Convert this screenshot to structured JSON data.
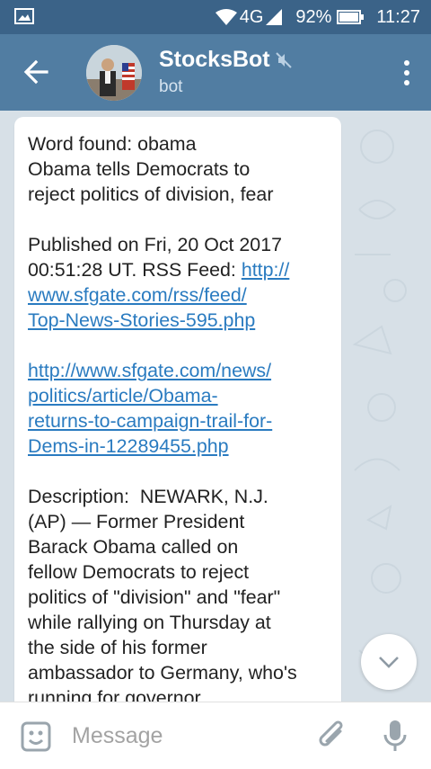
{
  "status_bar": {
    "network": "4G",
    "battery": "92%",
    "time": "11:27",
    "icons": [
      "image-notification-icon",
      "wifi-icon",
      "signal-icon",
      "battery-icon"
    ]
  },
  "header": {
    "title": "StocksBot",
    "subtitle": "bot",
    "icons": [
      "back-arrow-icon",
      "muted-icon",
      "more-vert-icon"
    ]
  },
  "message": {
    "line1": "Word found: obama",
    "line2": "Obama tells Democrats to\nreject politics of division, fear",
    "published_prefix": "Published on Fri, 20 Oct 2017\n00:51:28 UT. RSS Feed: ",
    "rss_link": "http://\nwww.sfgate.com/rss/feed/\nTop-News-Stories-595.php",
    "article_link": "http://www.sfgate.com/news/\npolitics/article/Obama-\nreturns-to-campaign-trail-for-\nDems-in-12289455.php",
    "description": "Description:  NEWARK, N.J.\n(AP) — Former President\nBarack Obama called on\nfellow Democrats to reject\npolitics of \"division\" and \"fear\"\nwhile rallying on Thursday at\nthe side of his former\nambassador to Germany, who's\nrunning for governor."
  },
  "input": {
    "placeholder": "Message",
    "icons": [
      "emoji-icon",
      "attach-icon",
      "mic-icon"
    ]
  },
  "colors": {
    "status_bar": "#3b6388",
    "header": "#517da2",
    "chat_bg": "#d7e0e7",
    "link": "#2a7bc0"
  }
}
